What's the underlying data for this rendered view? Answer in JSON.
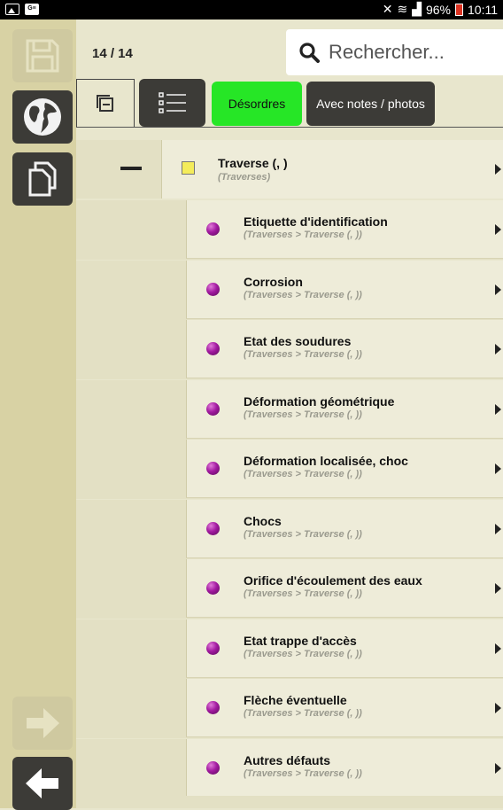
{
  "status_bar": {
    "battery": "96%",
    "time": "10:11"
  },
  "header": {
    "counter": "14 / 14",
    "search_placeholder": "Rechercher..."
  },
  "tools": {
    "desordres_label": "Désordres",
    "notes_label": "Avec notes / photos"
  },
  "colors": {
    "accent_green": "#26e626",
    "dark_button": "#3c3b37",
    "rail": "#d8d2a4",
    "background": "#e8e6cd",
    "bullet": "#a21aa0",
    "parent_marker": "#f4ec5b"
  },
  "tree": {
    "parent": {
      "title": "Traverse (, )",
      "subtitle": "(Traverses)"
    },
    "children": [
      {
        "title": "Etiquette d'identification",
        "subtitle": "(Traverses > Traverse (, ))"
      },
      {
        "title": "Corrosion",
        "subtitle": "(Traverses > Traverse (, ))"
      },
      {
        "title": "Etat des soudures",
        "subtitle": "(Traverses > Traverse (, ))"
      },
      {
        "title": "Déformation géométrique",
        "subtitle": "(Traverses > Traverse (, ))"
      },
      {
        "title": "Déformation localisée, choc",
        "subtitle": "(Traverses > Traverse (, ))"
      },
      {
        "title": "Chocs",
        "subtitle": "(Traverses > Traverse (, ))"
      },
      {
        "title": "Orifice d'écoulement des eaux",
        "subtitle": "(Traverses > Traverse (, ))"
      },
      {
        "title": "Etat trappe d'accès",
        "subtitle": "(Traverses > Traverse (, ))"
      },
      {
        "title": "Flèche éventuelle",
        "subtitle": "(Traverses > Traverse (, ))"
      },
      {
        "title": "Autres défauts",
        "subtitle": "(Traverses > Traverse (, ))"
      }
    ]
  },
  "icons": {
    "rail": [
      "save-icon",
      "globe-icon",
      "copy-icon",
      "arrow-right-icon",
      "arrow-left-icon"
    ],
    "tools": [
      "collapse-icon",
      "list-icon"
    ],
    "row": [
      "chevron-right-icon"
    ]
  }
}
